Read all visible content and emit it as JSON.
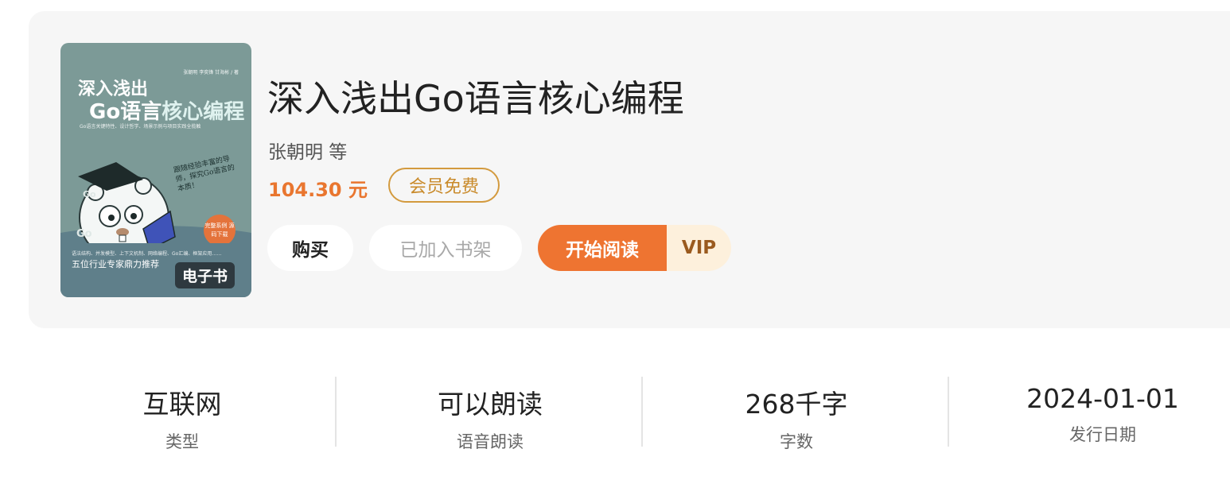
{
  "book": {
    "title": "深入浅出Go语言核心编程",
    "author": "张朝明 等",
    "price": "104.30 元",
    "member_badge": "会员免费",
    "cover": {
      "authors_line": "张朝明  李奕锋  甘海彬  /  著",
      "title_line1": "深入浅出",
      "title_line2_a": "Go语言",
      "title_line2_b": "核心编程",
      "subtitle": "Go语言关键特性、设计哲学、场景示例与项目实践全揽触",
      "blurb": "跟随经验丰富的导师，探究Go语言的本质！",
      "sticker": "完整系例 源码下载",
      "topics": "语法结构、并发模型、上下文机制、网络编程、Go汇编、框架应用……",
      "recommend": "五位行业专家鼎力推荐",
      "badge": "电子书"
    }
  },
  "actions": {
    "buy": "购买",
    "shelf": "已加入书架",
    "read": "开始阅读",
    "vip": "VIP"
  },
  "stats": [
    {
      "value": "互联网",
      "label": "类型"
    },
    {
      "value": "可以朗读",
      "label": "语音朗读"
    },
    {
      "value": "268千字",
      "label": "字数"
    },
    {
      "value": "2024-01-01",
      "label": "发行日期"
    }
  ],
  "colors": {
    "accent_orange": "#ee7431",
    "price_orange": "#e9762f",
    "gold": "#d39a3e",
    "card_bg": "#f6f6f6",
    "cover_bg": "#7c9a97"
  }
}
